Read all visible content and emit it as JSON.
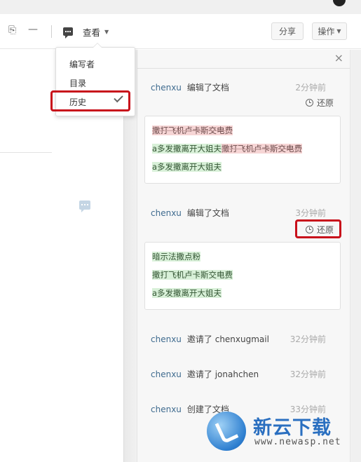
{
  "toolbar": {
    "view_label": "查看",
    "share_label": "分享",
    "actions_label": "操作",
    "paperclip_glyph": "⎘",
    "dash_glyph": "—"
  },
  "view_menu": {
    "items": [
      {
        "label": "编写者",
        "checked": false
      },
      {
        "label": "目录",
        "checked": false
      },
      {
        "label": "历史",
        "checked": true
      }
    ]
  },
  "history": {
    "close_glyph": "×",
    "restore_label": "还原",
    "entries": [
      {
        "user": "chenxu",
        "action": "编辑了文档",
        "time": "2分钟前"
      },
      {
        "user": "chenxu",
        "action": "编辑了文档",
        "time": "3分钟前"
      },
      {
        "user": "chenxu",
        "action": "邀请了 chenxugmail",
        "time": "32分钟前"
      },
      {
        "user": "chenxu",
        "action": "邀请了 jonahchen",
        "time": "32分钟前"
      },
      {
        "user": "chenxu",
        "action": "创建了文档",
        "time": "33分钟前"
      }
    ],
    "diff1": {
      "line1_deleted": "撒打飞机卢卡斯交电费",
      "line2_inserted": "a多发撒离开大姐夫",
      "line2_deleted": "撒打飞机卢卡斯交电费",
      "line3_inserted": "a多发撒离开大姐夫"
    },
    "diff2": {
      "line1_inserted": "暗示法撒点粉",
      "line2_inserted": "撒打飞机卢卡斯交电费",
      "line3_inserted": "a多发撒离开大姐夫"
    }
  },
  "watermark": {
    "brand": "新云下载",
    "url": "www.newasp.net"
  },
  "colors": {
    "highlight_red": "#c8101b",
    "user_blue": "#3f6b8f",
    "deleted_bg": "#f6d5d5",
    "inserted_bg": "#d8f0d8"
  }
}
